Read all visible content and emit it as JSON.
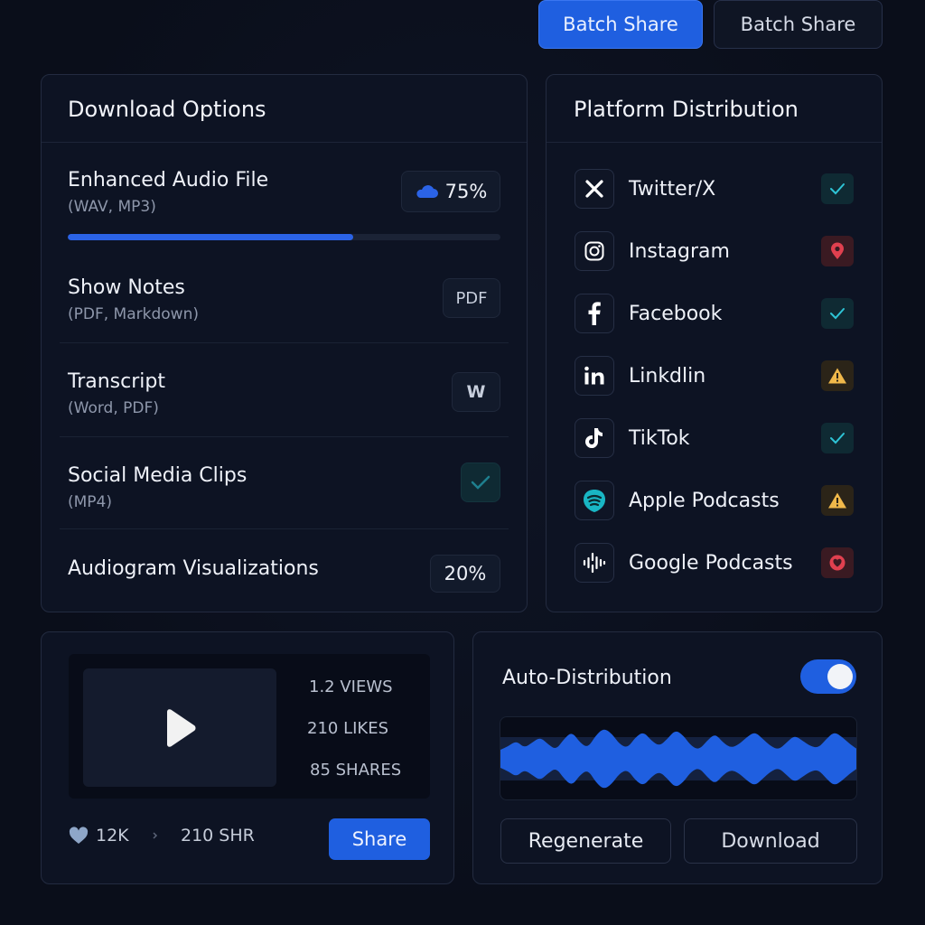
{
  "top_buttons": {
    "primary": "Batch Share",
    "secondary": "Batch Share"
  },
  "download_options": {
    "title": "Download Options",
    "items": [
      {
        "name": "Enhanced Audio File",
        "sub": "(WAV, MP3)",
        "badge": "75%",
        "progress": 0.66
      },
      {
        "name": "Show Notes",
        "sub": "(PDF, Markdown)",
        "badge": "PDF"
      },
      {
        "name": "Transcript",
        "sub": "(Word, PDF)",
        "badge": "W"
      },
      {
        "name": "Social Media Clips",
        "sub": "(MP4)",
        "badge": "check"
      },
      {
        "name": "Audiogram Visualizations",
        "badge": "20%"
      }
    ]
  },
  "platform_distribution": {
    "title": "Platform Distribution",
    "platforms": [
      {
        "name": "Twitter/X",
        "icon": "x-icon",
        "status": "ok"
      },
      {
        "name": "Instagram",
        "icon": "instagram-icon",
        "status": "error"
      },
      {
        "name": "Facebook",
        "icon": "facebook-icon",
        "status": "ok"
      },
      {
        "name": "Linkdlin",
        "icon": "linkedin-icon",
        "status": "warning"
      },
      {
        "name": "TikTok",
        "icon": "tiktok-icon",
        "status": "ok"
      },
      {
        "name": "Apple Podcasts",
        "icon": "apple-podcasts-icon",
        "status": "warning"
      },
      {
        "name": "Google Podcasts",
        "icon": "google-podcasts-icon",
        "status": "error"
      }
    ]
  },
  "video": {
    "views": "1.2 VIEWS",
    "likes": "210 LIKES",
    "shares": "85 SHARES",
    "heart_count": "12K",
    "shr_count": "210 SHR",
    "share_label": "Share"
  },
  "auto_distribution": {
    "title": "Auto-Distribution",
    "enabled": true,
    "regenerate_label": "Regenerate",
    "download_label": "Download"
  },
  "colors": {
    "accent": "#1f5fe0",
    "ok": "#2ec4d6",
    "error": "#e0404f",
    "warning": "#f0b84a"
  }
}
